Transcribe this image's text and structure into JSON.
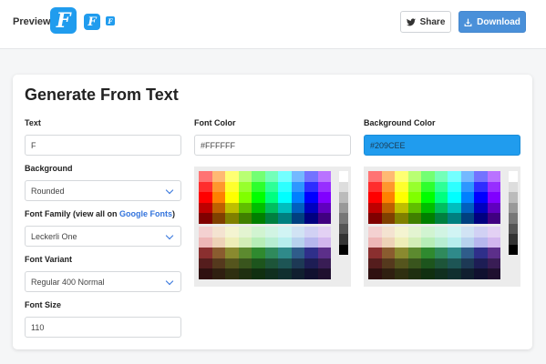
{
  "header": {
    "preview_label": "Preview",
    "preview_char": "F",
    "share_label": "Share",
    "download_label": "Download",
    "brand_color": "#209CEE"
  },
  "card": {
    "title": "Generate From Text",
    "text_field": {
      "label": "Text",
      "value": "F"
    },
    "background": {
      "label": "Background",
      "value": "Rounded"
    },
    "font_family": {
      "label": "Font Family (view all on ",
      "link": "Google Fonts",
      "label_end": ")",
      "value": "Leckerli One"
    },
    "font_variant": {
      "label": "Font Variant",
      "value": "Regular 400 Normal"
    },
    "font_size": {
      "label": "Font Size",
      "value": "110"
    },
    "font_color": {
      "label": "Font Color",
      "value": "#FFFFFF"
    },
    "bg_color": {
      "label": "Background Color",
      "value": "#209CEE"
    }
  },
  "palette": {
    "hues": [
      "#ff0000",
      "#ff8000",
      "#ffff00",
      "#80ff00",
      "#00ff00",
      "#00ff80",
      "#00ffff",
      "#0080ff",
      "#0000ff",
      "#8000ff",
      "#ff00ff"
    ],
    "grays": [
      "#ffffff",
      "#dddddd",
      "#bbbbbb",
      "#999999",
      "#777777",
      "#555555",
      "#333333",
      "#000000"
    ]
  }
}
